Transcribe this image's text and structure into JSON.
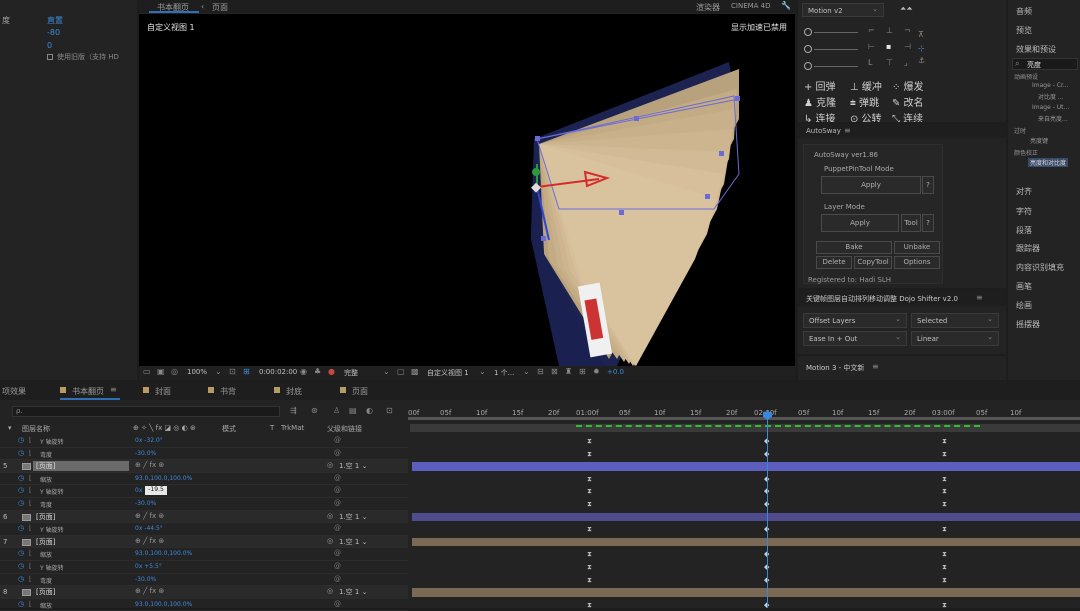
{
  "top_left_panel": {
    "row1_label": "度",
    "row1_value": "直置",
    "row2_value": "-80",
    "row3_value": "0",
    "checkbox_label": "使用旧版（支持 HD"
  },
  "comp_viewer": {
    "tabs": [
      "书本翻页",
      "页面"
    ],
    "renderer_labels": [
      "渲染器",
      "CINEMA 4D"
    ],
    "view_name": "自定义视图 1",
    "accel_status": "显示加速已禁用",
    "toolbar": {
      "zoom": "100%",
      "timecode": "0:00:02:00",
      "quality": "完整",
      "view": "自定义视图 1",
      "views_count": "1 个...",
      "exposure": "+0.0"
    }
  },
  "motion_panel": {
    "title": "Motion v2",
    "actions": [
      [
        "+ 回弹",
        "⊥ 缓冲",
        "⁘ 爆发"
      ],
      [
        "♟ 克隆",
        "⩧ 弹跳",
        "✎ 改名"
      ],
      [
        "↳ 连接",
        "⊙ 公转",
        "⤡ 连续"
      ]
    ]
  },
  "autosway": {
    "panel_title": "AutoSway",
    "version": "AutoSway ver1.86",
    "puppet_mode": "PuppetPinTool Mode",
    "apply": "Apply",
    "help": "?",
    "layer_mode": "Layer Mode",
    "tool": "Tool",
    "bake": "Bake",
    "unbake": "Unbake",
    "delete": "Delete",
    "copytool": "CopyTool",
    "options": "Options",
    "registered": "Registered to:  Hadi SLH"
  },
  "dojo": {
    "title": "关键帧图层自动排列移动调整 Dojo Shifter v2.0",
    "offset": "Offset Layers",
    "selected": "Selected",
    "ease": "Ease In + Out",
    "linear": "Linear"
  },
  "motion3": {
    "title": "Motion 3 - 中文新"
  },
  "right_sidebar": {
    "items_top": [
      "音频",
      "预览",
      "效果和预设"
    ],
    "search": "亮度",
    "tree": [
      "动画预设",
      "Image - Cr...",
      "对比度 ...",
      "Image - Ut...",
      "来自亮度...",
      "过时",
      "亮度键",
      "颜色校正",
      "亮度和对比度"
    ],
    "items_bottom": [
      "对齐",
      "字符",
      "段落",
      "跟踪器",
      "内容识别填充",
      "画笔",
      "绘画",
      "摇摆器"
    ]
  },
  "timeline": {
    "tabs": [
      "项效果",
      "书本翻页",
      "封面",
      "书背",
      "封底",
      "页面"
    ],
    "search_placeholder": "ρ.",
    "ruler": [
      "00f",
      "05f",
      "10f",
      "15f",
      "20f",
      "01:00f",
      "05f",
      "10f",
      "15f",
      "20f",
      "02:00f",
      "05f",
      "10f",
      "15f",
      "20f",
      "03:00f",
      "05f",
      "10f"
    ],
    "headers": {
      "layer_name": "图层名称",
      "mode": "模式",
      "t": "T",
      "trkmat": "TrkMat",
      "parent": "父级和链接"
    },
    "rows": [
      {
        "num": "",
        "name": "Y 轴旋转",
        "value": "0x -32.0°",
        "kind": "prop"
      },
      {
        "num": "",
        "name": "弯度",
        "value": "-30.0%",
        "kind": "prop"
      },
      {
        "num": "5",
        "name": "[页面]",
        "parent": "1.空 1",
        "kind": "layer",
        "selected": true
      },
      {
        "num": "",
        "name": "缩放",
        "value": "93.0,100.0,100.0%",
        "kind": "prop"
      },
      {
        "num": "",
        "name": "Y 轴旋转",
        "value": "0x -19.5°",
        "kind": "prop",
        "editing": true
      },
      {
        "num": "",
        "name": "弯度",
        "value": "-30.0%",
        "kind": "prop"
      },
      {
        "num": "6",
        "name": "[页面]",
        "parent": "1.空 1",
        "kind": "layer"
      },
      {
        "num": "",
        "name": "Y 轴旋转",
        "value": "0x -44.5°",
        "kind": "prop"
      },
      {
        "num": "7",
        "name": "[页面]",
        "parent": "1.空 1",
        "kind": "layer"
      },
      {
        "num": "",
        "name": "缩放",
        "value": "93.0,100.0,100.0%",
        "kind": "prop"
      },
      {
        "num": "",
        "name": "Y 轴旋转",
        "value": "0x +5.5°",
        "kind": "prop"
      },
      {
        "num": "",
        "name": "弯度",
        "value": "-30.0%",
        "kind": "prop"
      },
      {
        "num": "8",
        "name": "[页面]",
        "parent": "1.空 1",
        "kind": "layer"
      },
      {
        "num": "",
        "name": "缩放",
        "value": "93.0,100.0,100.0%",
        "kind": "prop"
      }
    ],
    "edit_value": "-19.5",
    "playhead_frame": 48,
    "bar_colors": {
      "layer5": "#5d5fbe",
      "layer6": "#4f4b8f",
      "layer7": "#7a6a55",
      "layer8": "#7a6a55"
    }
  }
}
